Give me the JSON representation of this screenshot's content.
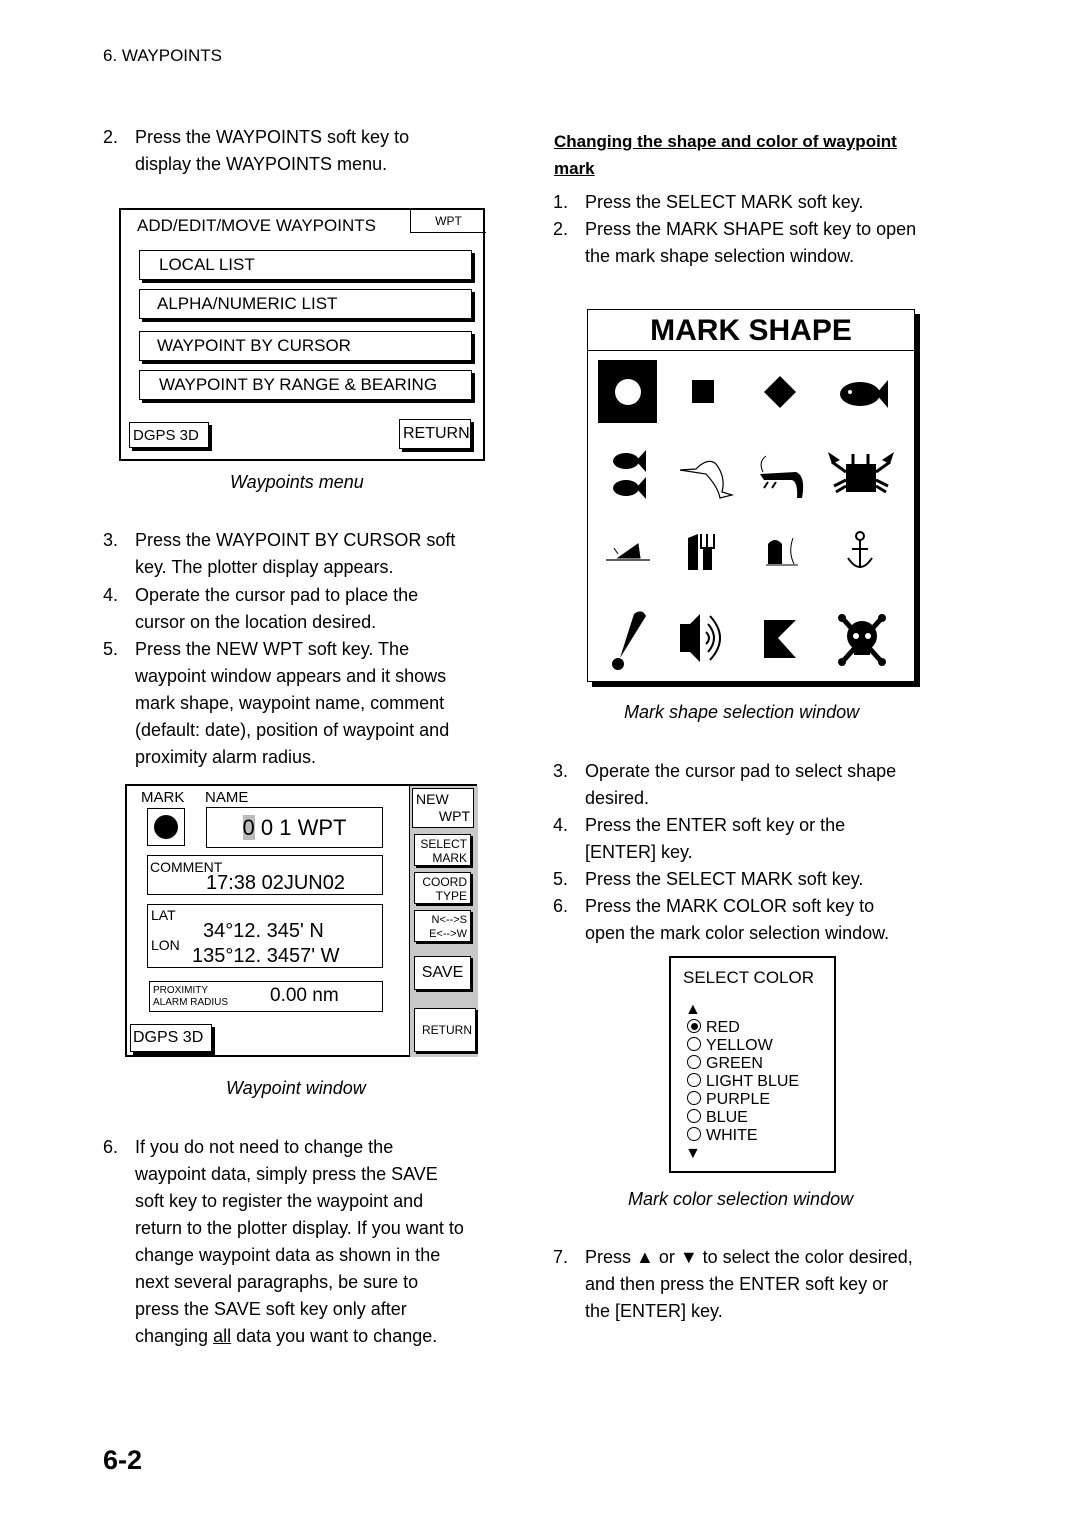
{
  "header": "6. WAYPOINTS",
  "left_steps": [
    {
      "num": "2.",
      "lines": [
        "Press the WAYPOINTS soft key to",
        "display the WAYPOINTS menu."
      ]
    },
    {
      "num": "3.",
      "lines": [
        "Press the WAYPOINT BY CURSOR soft",
        "key. The plotter display appears."
      ]
    },
    {
      "num": "4.",
      "lines": [
        "Operate the cursor pad to place the",
        "cursor on the location desired."
      ]
    },
    {
      "num": "5.",
      "lines": [
        "Press the NEW WPT soft key. The",
        "waypoint window appears and it shows",
        "mark shape, waypoint name, comment",
        "(default: date), position of waypoint and",
        "proximity alarm radius."
      ]
    },
    {
      "num": "6.",
      "lines": [
        "If you do not need to change the",
        "waypoint data, simply press the SAVE",
        "soft key to register the waypoint and",
        "return to the plotter display. If you want to",
        "change waypoint data as shown in the",
        "next several paragraphs, be sure to",
        "press the SAVE soft key only after"
      ],
      "last_pre": "changing ",
      "last_underlined": "all",
      "last_post": " data you want to change."
    }
  ],
  "waypoints_menu": {
    "title": "ADD/EDIT/MOVE WAYPOINTS",
    "tab": "WPT",
    "items": [
      "LOCAL LIST",
      "ALPHA/NUMERIC LIST",
      "WAYPOINT BY CURSOR",
      "WAYPOINT BY RANGE & BEARING"
    ],
    "status": "DGPS 3D",
    "return": "RETURN",
    "caption": "Waypoints menu"
  },
  "waypoint_window": {
    "mark_label": "MARK",
    "name_label": "NAME",
    "name_cursor": "0",
    "name_rest": " 0 1 WPT",
    "comment_label": "COMMENT",
    "comment": "17:38  02JUN02",
    "lat_label": "LAT",
    "lon_label": "LON",
    "lat": "34°12. 345'  N",
    "lon": "135°12. 3457' W",
    "prox_label1": "PROXIMITY",
    "prox_label2": "ALARM RADIUS",
    "prox": "0.00 nm",
    "status": "DGPS 3D",
    "softkeys": {
      "new1": "NEW",
      "new2": "WPT",
      "sel1": "SELECT",
      "sel2": "MARK",
      "coord1": "COORD",
      "coord2": "TYPE",
      "ns": "N<-->S",
      "ew": "E<-->W",
      "save": "SAVE",
      "ret": "RETURN"
    },
    "caption": "Waypoint window"
  },
  "right": {
    "heading_line1": "Changing the shape and color of waypoint",
    "heading_line2": "mark",
    "steps_a": [
      {
        "num": "1.",
        "lines": [
          "Press the SELECT MARK soft key."
        ]
      },
      {
        "num": "2.",
        "lines": [
          "Press the MARK SHAPE soft key to open",
          "the mark shape selection window."
        ]
      }
    ],
    "steps_b": [
      {
        "num": "3.",
        "lines": [
          "Operate the cursor pad to select shape",
          "desired."
        ]
      },
      {
        "num": "4.",
        "lines": [
          "Press the ENTER soft key or the",
          "[ENTER] key."
        ]
      },
      {
        "num": "5.",
        "lines": [
          "Press the SELECT MARK soft key."
        ]
      },
      {
        "num": "6.",
        "lines": [
          "Press the MARK COLOR soft key to",
          "open the mark color selection window."
        ]
      }
    ],
    "steps_c": [
      {
        "num": "7.",
        "lines": [
          "Press ▲ or ▼ to select the color desired,",
          "and then press the ENTER soft key or",
          "the [ENTER] key."
        ]
      }
    ]
  },
  "mark_shape": {
    "title": "MARK SHAPE",
    "selected": "circle",
    "icons": [
      "circle-icon",
      "square-icon",
      "diamond-icon",
      "fish-icon",
      "two-fish-icon",
      "marlin-icon",
      "shrimp-icon",
      "crab-icon",
      "wreck-icon",
      "restaurant-icon",
      "tombstone-icon",
      "anchor-icon",
      "exclamation-icon",
      "speaker-icon",
      "flag-icon",
      "skull-crossbones-icon"
    ],
    "caption": "Mark shape selection window"
  },
  "select_color": {
    "title": "SELECT COLOR",
    "up": "▲",
    "down": "▼",
    "options": [
      "RED",
      "YELLOW",
      "GREEN",
      "LIGHT BLUE",
      "PURPLE",
      "BLUE",
      "WHITE"
    ],
    "selected": "RED",
    "caption": "Mark color selection window"
  },
  "page_number": "6-2"
}
